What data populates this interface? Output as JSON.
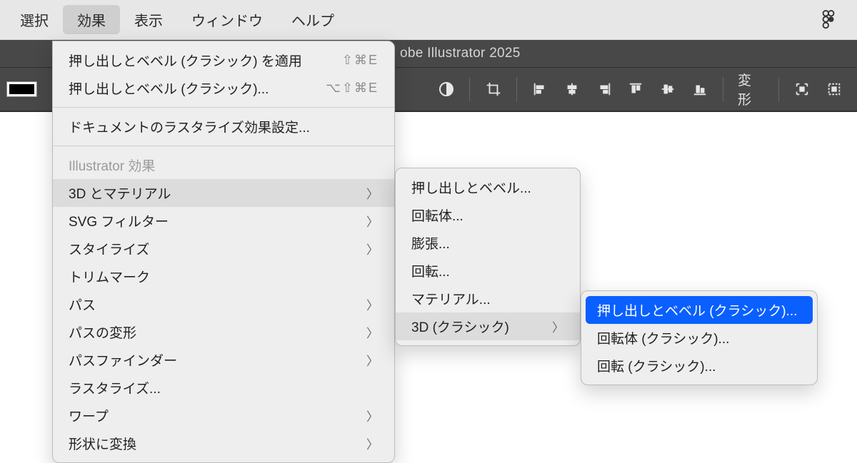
{
  "menubar": {
    "items": [
      "選択",
      "効果",
      "表示",
      "ウィンドウ",
      "ヘルプ"
    ],
    "active_index": 1
  },
  "app_title": "obe Illustrator 2025",
  "toolbar": {
    "transform_label": "変形"
  },
  "menu_main": {
    "apply_last": {
      "label": "押し出しとベベル (クラシック) を適用",
      "shortcut": "⇧⌘E"
    },
    "last_settings": {
      "label": "押し出しとベベル (クラシック)...",
      "shortcut": "⌥⇧⌘E"
    },
    "rasterize_settings": "ドキュメントのラスタライズ効果設定...",
    "section_label": "Illustrator 効果",
    "items": [
      {
        "label": "3D とマテリアル",
        "has_sub": true,
        "highlight": true
      },
      {
        "label": "SVG フィルター",
        "has_sub": true
      },
      {
        "label": "スタイライズ",
        "has_sub": true
      },
      {
        "label": "トリムマーク",
        "has_sub": false
      },
      {
        "label": "パス",
        "has_sub": true
      },
      {
        "label": "パスの変形",
        "has_sub": true
      },
      {
        "label": "パスファインダー",
        "has_sub": true
      },
      {
        "label": "ラスタライズ...",
        "has_sub": false
      },
      {
        "label": "ワープ",
        "has_sub": true
      },
      {
        "label": "形状に変換",
        "has_sub": true
      }
    ]
  },
  "menu_sub1": {
    "items": [
      {
        "label": "押し出しとベベル...",
        "has_sub": false
      },
      {
        "label": "回転体...",
        "has_sub": false
      },
      {
        "label": "膨張...",
        "has_sub": false
      },
      {
        "label": "回転...",
        "has_sub": false
      },
      {
        "label": "マテリアル...",
        "has_sub": false
      },
      {
        "label": "3D (クラシック)",
        "has_sub": true,
        "highlight": true
      }
    ]
  },
  "menu_sub2": {
    "items": [
      {
        "label": "押し出しとベベル (クラシック)...",
        "selected": true
      },
      {
        "label": "回転体 (クラシック)...",
        "selected": false
      },
      {
        "label": "回転 (クラシック)...",
        "selected": false
      }
    ]
  }
}
